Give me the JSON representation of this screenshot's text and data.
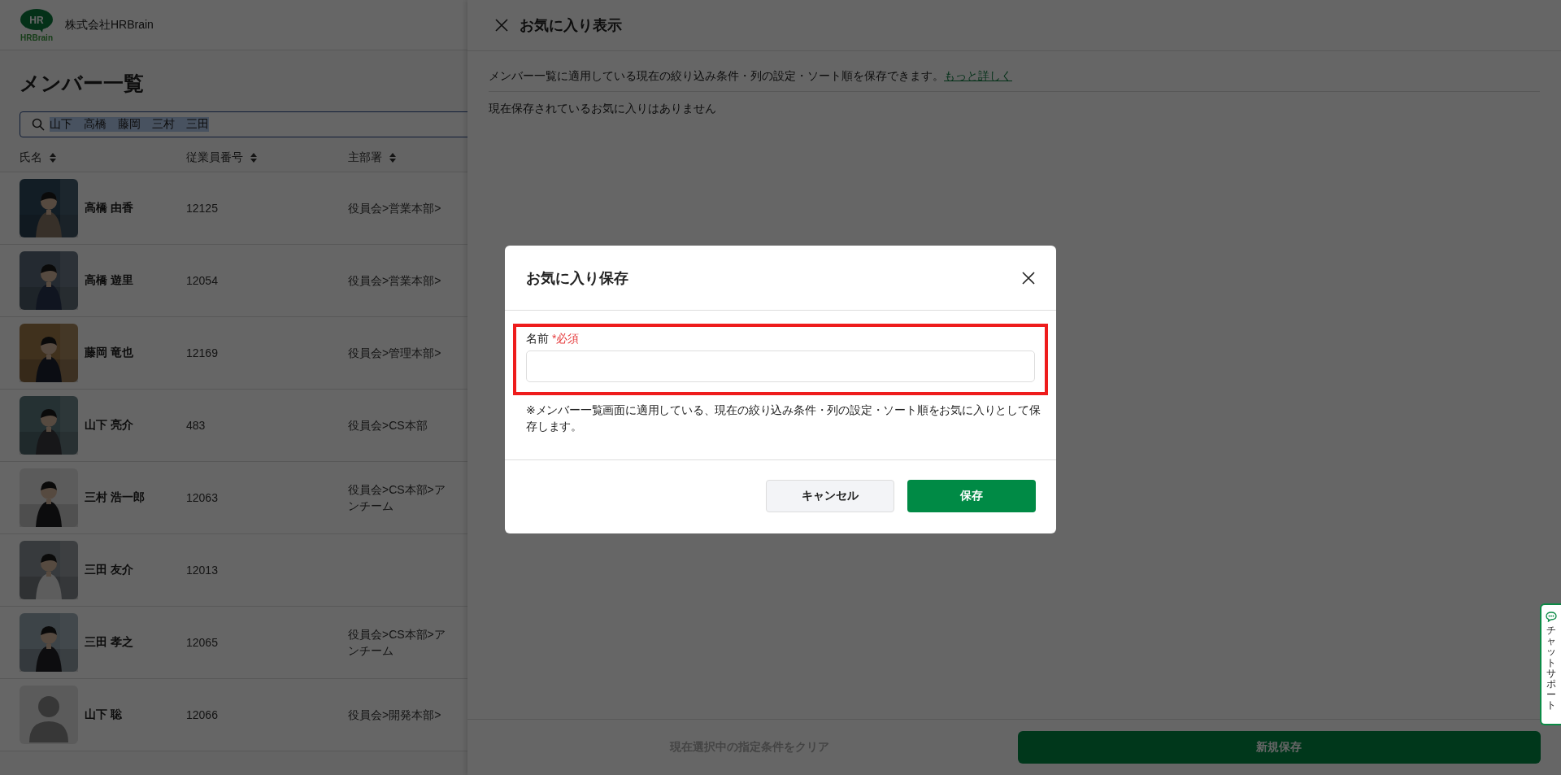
{
  "header": {
    "company": "株式会社HRBrain",
    "logo_text": "HR",
    "logo_word": "HRBrain"
  },
  "page": {
    "title": "メンバー一覧",
    "search": {
      "value": "山下　高橋　藤岡　三村　三田",
      "text_selected": true
    }
  },
  "table": {
    "columns": [
      "氏名",
      "従業員番号",
      "主部署"
    ],
    "rows": [
      {
        "name": "高橋 由香",
        "number": "12125",
        "dept": [
          "役員会>営業本部>"
        ],
        "avatar": {
          "kind": "picture"
        }
      },
      {
        "name": "高橋 遊里",
        "number": "12054",
        "dept": [
          "役員会>営業本部>"
        ],
        "avatar": {
          "kind": "picture"
        }
      },
      {
        "name": "藤岡 竜也",
        "number": "12169",
        "dept": [
          "役員会>管理本部>"
        ],
        "avatar": {
          "kind": "picture"
        }
      },
      {
        "name": "山下 亮介",
        "number": "483",
        "dept": [
          "役員会>CS本部"
        ],
        "avatar": {
          "kind": "picture"
        }
      },
      {
        "name": "三村 浩一郎",
        "number": "12063",
        "dept": [
          "役員会>CS本部>ア",
          "ンチーム"
        ],
        "avatar": {
          "kind": "picture"
        }
      },
      {
        "name": "三田 友介",
        "number": "12013",
        "avatar": {
          "kind": "picture"
        }
      },
      {
        "name": "三田 孝之",
        "number": "12065",
        "dept": [
          "役員会>CS本部>ア",
          "ンチーム"
        ],
        "avatar": {
          "kind": "picture"
        }
      },
      {
        "name": "山下 聡",
        "number": "12066",
        "dept": [
          "役員会>開発本部>"
        ],
        "avatar": {
          "kind": "placeholder"
        }
      }
    ]
  },
  "drawer": {
    "title": "お気に入り表示",
    "description": "メンバー一覧に適用している現在の絞り込み条件・列の設定・ソート順を保存できます。",
    "link": "もっと詳しく",
    "empty_message": "現在保存されているお気に入りはありません",
    "clear_button": {
      "label": "現在選択中の指定条件をクリア",
      "disabled": true
    },
    "save_button": "新規保存"
  },
  "dialog": {
    "title": "お気に入り保存",
    "field_label": "名前",
    "required": "*必須",
    "highlighted": true,
    "note": "※メンバー一覧画面に適用している、現在の絞り込み条件・列の設定・ソート順をお気に入りとして保存します。",
    "cancel": "キャンセル",
    "save": "保存"
  },
  "chat_support": "チャットサポート"
}
